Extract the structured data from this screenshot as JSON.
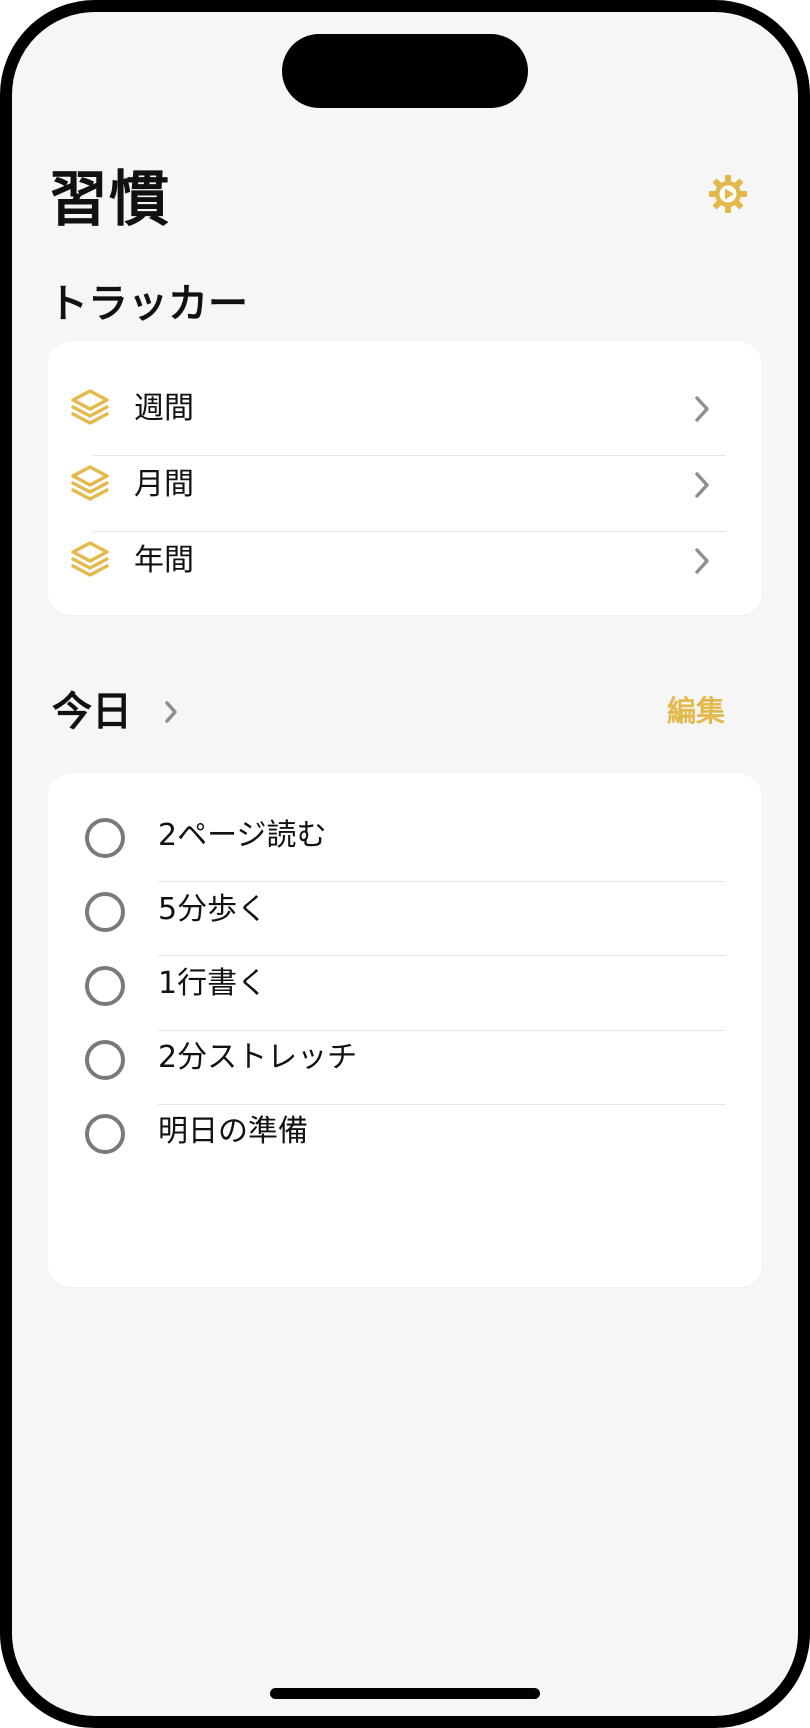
{
  "header": {
    "title": "習慣",
    "settings_icon": "gear-icon"
  },
  "trackers": {
    "title": "トラッカー",
    "items": [
      {
        "label": "週間",
        "icon": "stack-layers-icon"
      },
      {
        "label": "月間",
        "icon": "stack-layers-icon"
      },
      {
        "label": "年間",
        "icon": "stack-layers-icon"
      }
    ]
  },
  "today": {
    "title": "今日",
    "edit_label": "編集",
    "habits": [
      {
        "label": "2ページ読む",
        "done": false
      },
      {
        "label": "5分歩く",
        "done": false
      },
      {
        "label": "1行書く",
        "done": false
      },
      {
        "label": "2分ストレッチ",
        "done": false
      },
      {
        "label": "明日の準備",
        "done": false
      }
    ]
  },
  "colors": {
    "accent": "#e3b94b",
    "background": "#f6f6f6",
    "card": "#ffffff",
    "text": "#111111",
    "chevron": "#8e8e93"
  }
}
